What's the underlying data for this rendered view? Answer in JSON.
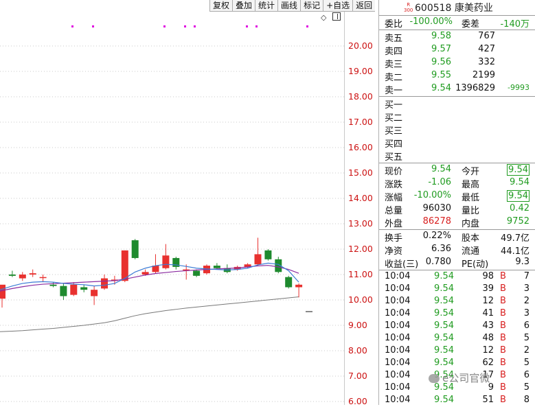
{
  "toolbar": {
    "items": [
      "复权",
      "叠加",
      "统计",
      "画线",
      "标记",
      "+自选",
      "返回"
    ]
  },
  "icons": {
    "diamond": "diamond-icon",
    "collapse": "panel-collapse-icon"
  },
  "chart_data": {
    "type": "candlestick",
    "y_axis_labels": [
      "20.00",
      "19.00",
      "18.00",
      "17.00",
      "16.00",
      "15.00",
      "14.00",
      "13.00",
      "12.00",
      "11.00",
      "10.00",
      "9.00",
      "8.00",
      "7.00",
      "6.00"
    ],
    "ylim": [
      6.0,
      20.0
    ],
    "colors": {
      "up": "#e8312f",
      "down": "#1e8a2e",
      "ma_long": "#777777",
      "ma_purple": "#8a2ba0",
      "ma_blue": "#3a7bd5",
      "marker": "#e000e0"
    },
    "candles": [
      {
        "o": 10.05,
        "h": 10.55,
        "l": 9.7,
        "c": 10.6
      },
      {
        "o": 11.0,
        "h": 11.15,
        "l": 10.9,
        "c": 10.95
      },
      {
        "o": 10.85,
        "h": 11.1,
        "l": 10.75,
        "c": 11.0
      },
      {
        "o": 11.0,
        "h": 11.2,
        "l": 10.9,
        "c": 11.05
      },
      {
        "o": 10.9,
        "h": 11.0,
        "l": 10.7,
        "c": 10.9
      },
      {
        "o": 10.6,
        "h": 10.7,
        "l": 10.5,
        "c": 10.55
      },
      {
        "o": 10.55,
        "h": 10.65,
        "l": 10.0,
        "c": 10.15
      },
      {
        "o": 10.2,
        "h": 10.7,
        "l": 10.15,
        "c": 10.6
      },
      {
        "o": 10.5,
        "h": 10.6,
        "l": 10.3,
        "c": 10.4
      },
      {
        "o": 10.15,
        "h": 10.55,
        "l": 9.8,
        "c": 10.4
      },
      {
        "o": 10.45,
        "h": 11.0,
        "l": 10.4,
        "c": 10.85
      },
      {
        "o": 10.75,
        "h": 10.95,
        "l": 10.6,
        "c": 10.8
      },
      {
        "o": 10.75,
        "h": 11.95,
        "l": 10.7,
        "c": 11.95
      },
      {
        "o": 12.35,
        "h": 12.4,
        "l": 11.6,
        "c": 11.65
      },
      {
        "o": 11.0,
        "h": 11.2,
        "l": 10.95,
        "c": 11.1
      },
      {
        "o": 11.1,
        "h": 11.8,
        "l": 11.05,
        "c": 11.35
      },
      {
        "o": 11.25,
        "h": 12.2,
        "l": 11.2,
        "c": 11.75
      },
      {
        "o": 11.65,
        "h": 11.7,
        "l": 11.2,
        "c": 11.3
      },
      {
        "o": 11.2,
        "h": 11.4,
        "l": 10.8,
        "c": 11.2
      },
      {
        "o": 11.15,
        "h": 11.2,
        "l": 10.9,
        "c": 10.95
      },
      {
        "o": 11.05,
        "h": 11.4,
        "l": 11.0,
        "c": 11.35
      },
      {
        "o": 11.35,
        "h": 11.45,
        "l": 11.2,
        "c": 11.25
      },
      {
        "o": 11.25,
        "h": 11.4,
        "l": 11.05,
        "c": 11.1
      },
      {
        "o": 11.2,
        "h": 11.35,
        "l": 11.15,
        "c": 11.3
      },
      {
        "o": 11.3,
        "h": 11.45,
        "l": 11.25,
        "c": 11.4
      },
      {
        "o": 11.4,
        "h": 12.45,
        "l": 11.35,
        "c": 11.8
      },
      {
        "o": 11.95,
        "h": 12.0,
        "l": 11.55,
        "c": 11.6
      },
      {
        "o": 11.6,
        "h": 11.7,
        "l": 11.05,
        "c": 11.1
      },
      {
        "o": 10.9,
        "h": 10.95,
        "l": 10.45,
        "c": 10.5
      },
      {
        "o": 10.5,
        "h": 10.65,
        "l": 10.1,
        "c": 10.6
      },
      {
        "o": 9.54,
        "h": 9.54,
        "l": 9.54,
        "c": 9.54
      }
    ],
    "ma_long": [
      8.75,
      8.77,
      8.79,
      8.82,
      8.85,
      8.88,
      8.92,
      8.96,
      9.0,
      9.05,
      9.1,
      9.18,
      9.28,
      9.38,
      9.46,
      9.52,
      9.58,
      9.63,
      9.68,
      9.72,
      9.76,
      9.8,
      9.84,
      9.88,
      9.92,
      9.96,
      10.0,
      10.04,
      10.08,
      10.12
    ],
    "ma_purple": [
      10.35,
      10.45,
      10.52,
      10.58,
      10.62,
      10.64,
      10.66,
      10.68,
      10.7,
      10.72,
      10.74,
      10.76,
      10.82,
      10.9,
      10.98,
      11.04,
      11.08,
      11.12,
      11.15,
      11.18,
      11.2,
      11.22,
      11.24,
      11.26,
      11.3,
      11.34,
      11.36,
      11.3,
      11.2,
      11.05
    ],
    "ma_blue": [
      10.4,
      10.55,
      10.65,
      10.7,
      10.72,
      10.7,
      10.65,
      10.62,
      10.6,
      10.55,
      10.58,
      10.65,
      10.85,
      11.1,
      11.25,
      11.35,
      11.4,
      11.38,
      11.32,
      11.25,
      11.22,
      11.2,
      11.18,
      11.2,
      11.25,
      11.38,
      11.45,
      11.4,
      11.15,
      10.7
    ],
    "markers_count": 7
  },
  "quote": {
    "code": "600518",
    "name": "康美药业",
    "badge_top": "R",
    "badge_bottom": "300",
    "weibi_label": "委比",
    "weibi_value": "-100.00%",
    "weicha_label": "委差",
    "weicha_value": "-140万",
    "asks": [
      {
        "label": "卖五",
        "price": "9.58",
        "vol": "767",
        "chg": ""
      },
      {
        "label": "卖四",
        "price": "9.57",
        "vol": "427",
        "chg": ""
      },
      {
        "label": "卖三",
        "price": "9.56",
        "vol": "332",
        "chg": ""
      },
      {
        "label": "卖二",
        "price": "9.55",
        "vol": "2199",
        "chg": ""
      },
      {
        "label": "卖一",
        "price": "9.54",
        "vol": "1396829",
        "chg": "-9993"
      }
    ],
    "bids": [
      {
        "label": "买一"
      },
      {
        "label": "买二"
      },
      {
        "label": "买三"
      },
      {
        "label": "买四"
      },
      {
        "label": "买五"
      }
    ],
    "stats": {
      "xianjia_label": "现价",
      "xianjia": "9.54",
      "jinkai_label": "今开",
      "jinkai": "9.54",
      "zhangdie_label": "涨跌",
      "zhangdie": "-1.06",
      "zuigao_label": "最高",
      "zuigao": "9.54",
      "zhangfu_label": "涨幅",
      "zhangfu": "-10.00%",
      "zuidi_label": "最低",
      "zuidi": "9.54",
      "zongliang_label": "总量",
      "zongliang": "96030",
      "liangbi_label": "量比",
      "liangbi": "0.42",
      "waipan_label": "外盘",
      "waipan": "86278",
      "neipan_label": "内盘",
      "neipan": "9752"
    },
    "fund": {
      "huanshou_label": "换手",
      "huanshou": "0.22%",
      "guben_label": "股本",
      "guben": "49.7亿",
      "jingzi_label": "净资",
      "jingzi": "6.36",
      "liutong_label": "流通",
      "liutong": "44.1亿",
      "shouyi_label": "收益(三)",
      "shouyi": "0.780",
      "pe_label": "PE(动)",
      "pe": "9.3"
    },
    "ticks": [
      {
        "time": "10:04",
        "price": "9.54",
        "vol": "98",
        "side": "B",
        "n": "7"
      },
      {
        "time": "10:04",
        "price": "9.54",
        "vol": "39",
        "side": "B",
        "n": "3"
      },
      {
        "time": "10:04",
        "price": "9.54",
        "vol": "12",
        "side": "B",
        "n": "2"
      },
      {
        "time": "10:04",
        "price": "9.54",
        "vol": "41",
        "side": "B",
        "n": "3"
      },
      {
        "time": "10:04",
        "price": "9.54",
        "vol": "43",
        "side": "B",
        "n": "6"
      },
      {
        "time": "10:04",
        "price": "9.54",
        "vol": "48",
        "side": "B",
        "n": "5"
      },
      {
        "time": "10:04",
        "price": "9.54",
        "vol": "12",
        "side": "B",
        "n": "2"
      },
      {
        "time": "10:04",
        "price": "9.54",
        "vol": "62",
        "side": "B",
        "n": "5"
      },
      {
        "time": "10:04",
        "price": "9.54",
        "vol": "17",
        "side": "B",
        "n": "6"
      },
      {
        "time": "10:04",
        "price": "9.54",
        "vol": "9",
        "side": "B",
        "n": "5"
      },
      {
        "time": "10:04",
        "price": "9.54",
        "vol": "51",
        "side": "B",
        "n": "8"
      }
    ]
  },
  "watermark": "e公司官微"
}
